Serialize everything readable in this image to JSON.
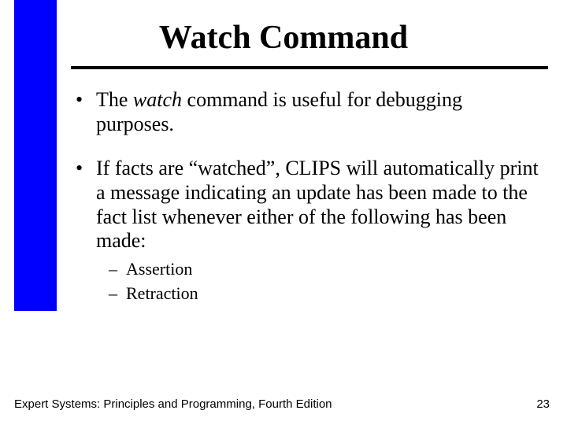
{
  "title": "Watch Command",
  "bullets": [
    {
      "prefix": "The ",
      "italic": "watch",
      "suffix": " command is useful for debugging purposes."
    },
    {
      "text": "If facts are “watched”, CLIPS will automatically print a message indicating an update has been made to the fact list whenever either of the following has been made:",
      "subs": [
        "Assertion",
        "Retraction"
      ]
    }
  ],
  "footer": {
    "left": "Expert Systems: Principles and Programming, Fourth Edition",
    "page": "23"
  }
}
